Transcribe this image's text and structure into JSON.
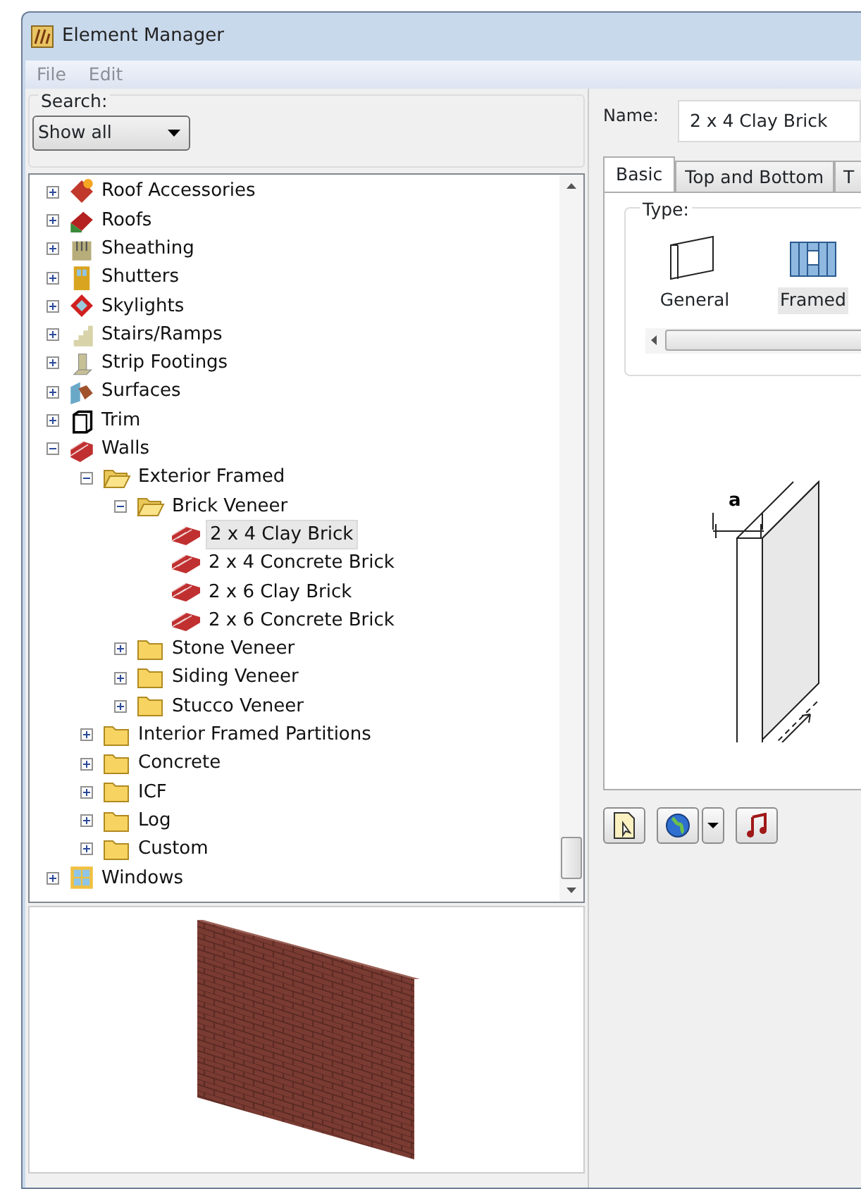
{
  "window": {
    "title": "Element Manager"
  },
  "menu": [
    {
      "label": "File"
    },
    {
      "label": "Edit"
    }
  ],
  "search": {
    "label": "Search:",
    "value": "Show all"
  },
  "tree": [
    {
      "label": "Roof Accessories",
      "kind": "category",
      "expanded": false,
      "selected": false
    },
    {
      "label": "Roofs",
      "kind": "category",
      "expanded": false,
      "selected": false
    },
    {
      "label": "Sheathing",
      "kind": "category",
      "expanded": false,
      "selected": false
    },
    {
      "label": "Shutters",
      "kind": "category",
      "expanded": false,
      "selected": false
    },
    {
      "label": "Skylights",
      "kind": "category",
      "expanded": false,
      "selected": false
    },
    {
      "label": "Stairs/Ramps",
      "kind": "category",
      "expanded": false,
      "selected": false
    },
    {
      "label": "Strip Footings",
      "kind": "category",
      "expanded": false,
      "selected": false
    },
    {
      "label": "Surfaces",
      "kind": "category",
      "expanded": false,
      "selected": false
    },
    {
      "label": "Trim",
      "kind": "category",
      "expanded": false,
      "selected": false
    },
    {
      "label": "Walls",
      "kind": "category",
      "expanded": true,
      "selected": false,
      "children": [
        {
          "label": "Exterior Framed",
          "kind": "folder",
          "expanded": true,
          "selected": false,
          "children": [
            {
              "label": "Brick Veneer",
              "kind": "folder",
              "expanded": true,
              "selected": false,
              "children": [
                {
                  "label": "2 x 4 Clay Brick",
                  "kind": "element",
                  "selected": true
                },
                {
                  "label": "2 x 4 Concrete Brick",
                  "kind": "element",
                  "selected": false
                },
                {
                  "label": "2 x 6 Clay Brick",
                  "kind": "element",
                  "selected": false
                },
                {
                  "label": "2 x 6 Concrete Brick",
                  "kind": "element",
                  "selected": false
                }
              ]
            },
            {
              "label": "Stone Veneer",
              "kind": "folder",
              "expanded": false,
              "selected": false
            },
            {
              "label": "Siding Veneer",
              "kind": "folder",
              "expanded": false,
              "selected": false
            },
            {
              "label": "Stucco Veneer",
              "kind": "folder",
              "expanded": false,
              "selected": false
            }
          ]
        },
        {
          "label": "Interior Framed Partitions",
          "kind": "folder",
          "expanded": false,
          "selected": false
        },
        {
          "label": "Concrete",
          "kind": "folder",
          "expanded": false,
          "selected": false
        },
        {
          "label": "ICF",
          "kind": "folder",
          "expanded": false,
          "selected": false
        },
        {
          "label": "Log",
          "kind": "folder",
          "expanded": false,
          "selected": false
        },
        {
          "label": "Custom",
          "kind": "folder",
          "expanded": false,
          "selected": false
        }
      ]
    },
    {
      "label": "Windows",
      "kind": "category",
      "expanded": false,
      "selected": false
    }
  ],
  "name_field": {
    "label": "Name:",
    "value": "2 x 4 Clay Brick"
  },
  "tabs": [
    {
      "label": "Basic",
      "selected": true
    },
    {
      "label": "Top and Bottom",
      "selected": false
    },
    {
      "label": "T",
      "selected": false
    }
  ],
  "type_group": {
    "label": "Type:",
    "items": [
      {
        "label": "General",
        "selected": false
      },
      {
        "label": "Framed",
        "selected": true
      }
    ]
  },
  "diagram": {
    "dimension_label": "a"
  }
}
